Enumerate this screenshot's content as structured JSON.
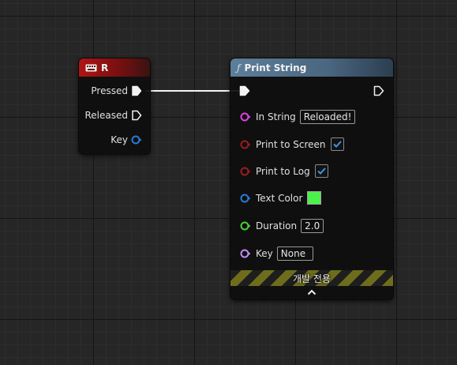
{
  "key_node": {
    "title": "R",
    "pins": {
      "pressed": "Pressed",
      "released": "Released",
      "key": "Key"
    }
  },
  "print_node": {
    "title": "Print String",
    "function_glyph": "ƒ",
    "inputs": {
      "in_string": {
        "label": "In String",
        "value": "Reloaded!"
      },
      "print_to_screen": {
        "label": "Print to Screen",
        "checked": true
      },
      "print_to_log": {
        "label": "Print to Log",
        "checked": true
      },
      "text_color": {
        "label": "Text Color",
        "color": "#4cf04c"
      },
      "duration": {
        "label": "Duration",
        "value": "2.0"
      },
      "key": {
        "label": "Key",
        "value": "None"
      }
    },
    "dev_only_banner": "개발 전용"
  },
  "colors": {
    "string_pin": "#e040e0",
    "bool_pin": "#9b1c1c",
    "struct_pin": "#2a79d6",
    "float_pin": "#4ccf3c",
    "name_pin": "#c58cf0"
  }
}
